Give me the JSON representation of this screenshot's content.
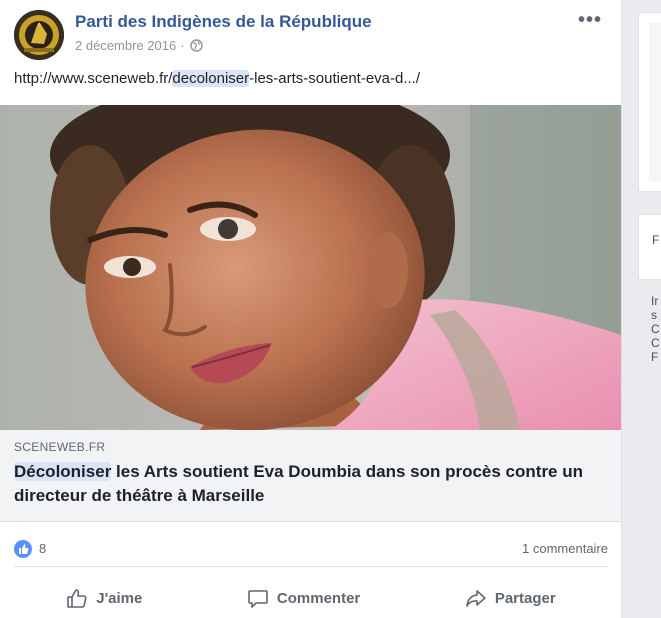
{
  "post": {
    "page_name": "Parti des Indigènes de la République",
    "date": "2 décembre 2016",
    "separator": "·",
    "more_label": "•••",
    "url_prefix": "http://www.sceneweb.fr/",
    "url_highlight": "decoloniser",
    "url_suffix": "-les-arts-soutient-eva-d.../"
  },
  "link_preview": {
    "domain": "SCENEWEB.FR",
    "title_highlight": "Décoloniser",
    "title_rest": " les Arts soutient Eva Doumbia dans son procès contre un directeur de théâtre à Marseille"
  },
  "stats": {
    "likes": "8",
    "comments": "1 commentaire"
  },
  "actions": {
    "like": "J'aime",
    "comment": "Commenter",
    "share": "Partager"
  },
  "sidebar": {
    "fragment_1": "F",
    "fragment_lines": [
      "Ir",
      "s",
      "C",
      "C",
      "F"
    ]
  },
  "icons": {
    "like_reaction": "like-icon",
    "globe": "globe-icon",
    "thumb": "thumbs-up-icon",
    "comment": "comment-icon",
    "share": "share-icon"
  },
  "colors": {
    "link_blue": "#365899",
    "reaction_blue": "#5890ff",
    "meta_gray": "#90949c",
    "highlight": "#dbe4f6"
  }
}
